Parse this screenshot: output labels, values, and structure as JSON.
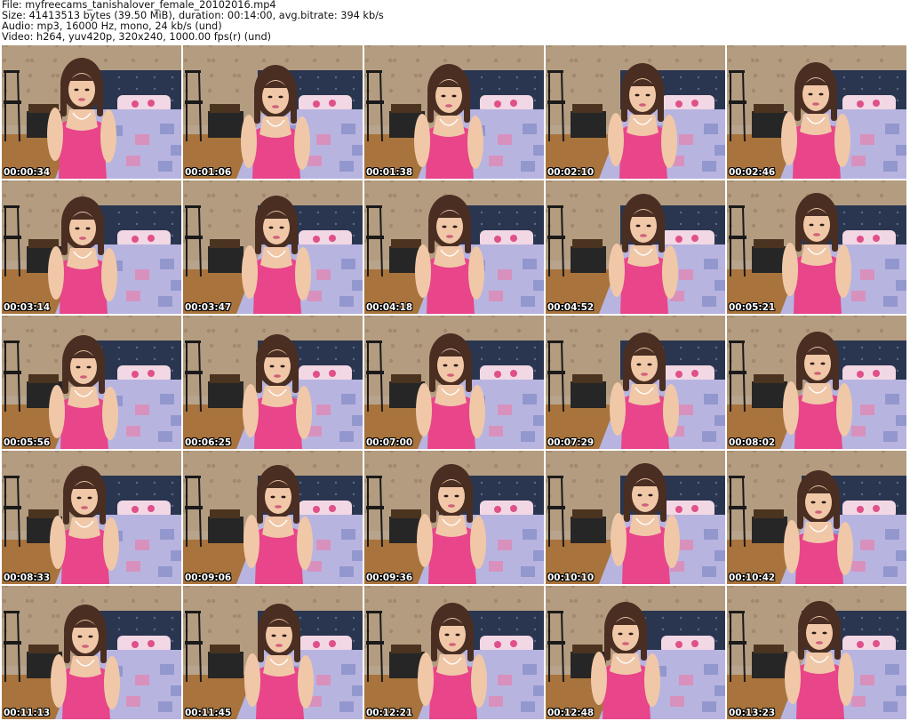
{
  "header": {
    "file_line": "File: myfreecams_tanishalover_female_20102016.mp4",
    "size_line": "Size: 41413513 bytes (39.50 MiB), duration: 00:14:00, avg.bitrate: 394 kb/s",
    "audio_line": "Audio: mp3, 16000 Hz, mono, 24 kb/s (und)",
    "video_line": "Video: h264, yuv420p, 320x240, 1000.00 fps(r) (und)"
  },
  "thumbnails": [
    {
      "timestamp": "00:00:34"
    },
    {
      "timestamp": "00:01:06"
    },
    {
      "timestamp": "00:01:38"
    },
    {
      "timestamp": "00:02:10"
    },
    {
      "timestamp": "00:02:46"
    },
    {
      "timestamp": "00:03:14"
    },
    {
      "timestamp": "00:03:47"
    },
    {
      "timestamp": "00:04:18"
    },
    {
      "timestamp": "00:04:52"
    },
    {
      "timestamp": "00:05:21"
    },
    {
      "timestamp": "00:05:56"
    },
    {
      "timestamp": "00:06:25"
    },
    {
      "timestamp": "00:07:00"
    },
    {
      "timestamp": "00:07:29"
    },
    {
      "timestamp": "00:08:02"
    },
    {
      "timestamp": "00:08:33"
    },
    {
      "timestamp": "00:09:06"
    },
    {
      "timestamp": "00:09:36"
    },
    {
      "timestamp": "00:10:10"
    },
    {
      "timestamp": "00:10:42"
    },
    {
      "timestamp": "00:11:13"
    },
    {
      "timestamp": "00:11:45"
    },
    {
      "timestamp": "00:12:21"
    },
    {
      "timestamp": "00:12:48"
    },
    {
      "timestamp": "00:13:23"
    }
  ],
  "colors": {
    "wall": "#b49c80",
    "headboard": "#2a3650",
    "bedspread": "#b8b4e0",
    "pillow": "#f2d8e4",
    "floor": "#a8733c",
    "top": "#e8458a",
    "skin": "#f0c8a8",
    "hair": "#4a2e22"
  }
}
